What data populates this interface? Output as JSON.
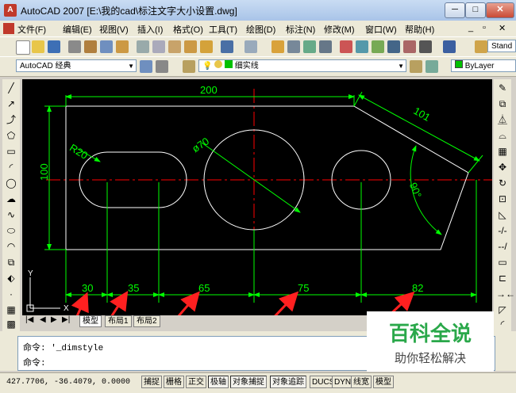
{
  "window": {
    "app_name": "AutoCAD 2007",
    "file_path": "[E:\\我的cad\\标注文字大小设置.dwg]",
    "app_icon_label": "A"
  },
  "menu": [
    "文件(F)",
    "编辑(E)",
    "视图(V)",
    "插入(I)",
    "格式(O)",
    "工具(T)",
    "绘图(D)",
    "标注(N)",
    "修改(M)",
    "窗口(W)",
    "帮助(H)"
  ],
  "toolbar": {
    "text_style_combo": "Stand",
    "workspace_combo": "AutoCAD 经典",
    "layer_combo": "细实线",
    "color_combo": "ByLayer"
  },
  "drawing": {
    "dim_200": "200",
    "dim_101": "101",
    "dim_r20": "R20",
    "dim_phi70": "ø70",
    "dim_100": "100",
    "dim_90": "90°",
    "dim_30": "30",
    "dim_35": "35",
    "dim_65": "65",
    "dim_75": "75",
    "dim_82": "82",
    "ucs_x": "X",
    "ucs_y": "Y"
  },
  "tabs": [
    "模型",
    "布局1",
    "布局2"
  ],
  "command": {
    "line1": "命令: '_dimstyle",
    "line2": "命令:"
  },
  "status": {
    "coords": "427.7706, -36.4079, 0.0000",
    "buttons": [
      "捕捉",
      "栅格",
      "正交",
      "极轴",
      "对象捕捉",
      "对象追踪",
      "DUCS",
      "DYN",
      "线宽",
      "模型"
    ]
  },
  "watermark": {
    "title": "百科全说",
    "subtitle": "助你轻松解决"
  },
  "colors": {
    "dimension": "#00ff00",
    "center_line": "#ff0000",
    "geometry": "#ffffff",
    "arrow_annotation": "#ff2020"
  }
}
